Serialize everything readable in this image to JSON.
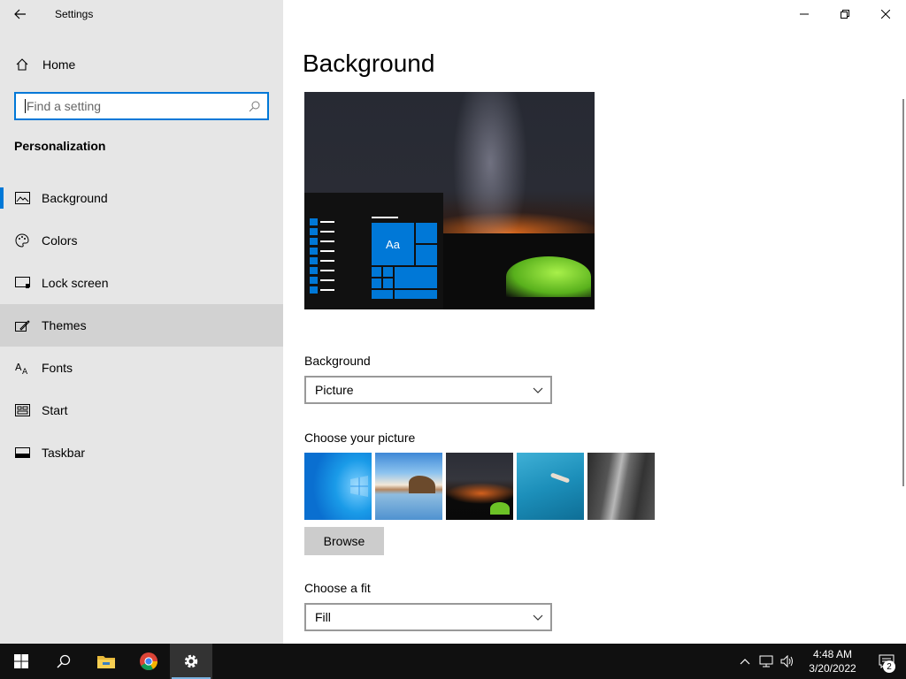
{
  "window": {
    "app_title": "Settings",
    "controls": [
      "minimize-icon",
      "restore-icon",
      "close-icon"
    ]
  },
  "sidebar": {
    "home_label": "Home",
    "search_placeholder": "Find a setting",
    "section_title": "Personalization",
    "items": [
      {
        "label": "Background",
        "icon": "picture-icon",
        "selected": true
      },
      {
        "label": "Colors",
        "icon": "palette-icon"
      },
      {
        "label": "Lock screen",
        "icon": "lock-screen-icon"
      },
      {
        "label": "Themes",
        "icon": "themes-brush-icon",
        "hovered": true
      },
      {
        "label": "Fonts",
        "icon": "fonts-icon"
      },
      {
        "label": "Start",
        "icon": "start-icon"
      },
      {
        "label": "Taskbar",
        "icon": "taskbar-icon"
      }
    ]
  },
  "main": {
    "page_title": "Background",
    "preview": {
      "tile_text": "Aa"
    },
    "background_label": "Background",
    "background_value": "Picture",
    "choose_picture_label": "Choose your picture",
    "pictures": [
      "windows-blue",
      "beach-rocks",
      "night-sky-tent",
      "underwater-swimmer",
      "rock-cliff"
    ],
    "browse_label": "Browse",
    "fit_label": "Choose a fit",
    "fit_value": "Fill"
  },
  "taskbar": {
    "apps": [
      "start-icon",
      "search-icon",
      "file-explorer-icon",
      "chrome-icon",
      "settings-gear-icon"
    ],
    "tray": [
      "chevron-up-icon",
      "network-icon",
      "volume-icon"
    ],
    "time": "4:48 AM",
    "date": "3/20/2022",
    "notification_count": "2"
  },
  "colors": {
    "accent": "#0078d7",
    "sidebar_bg": "#e6e6e6",
    "taskbar_bg": "#101010"
  }
}
